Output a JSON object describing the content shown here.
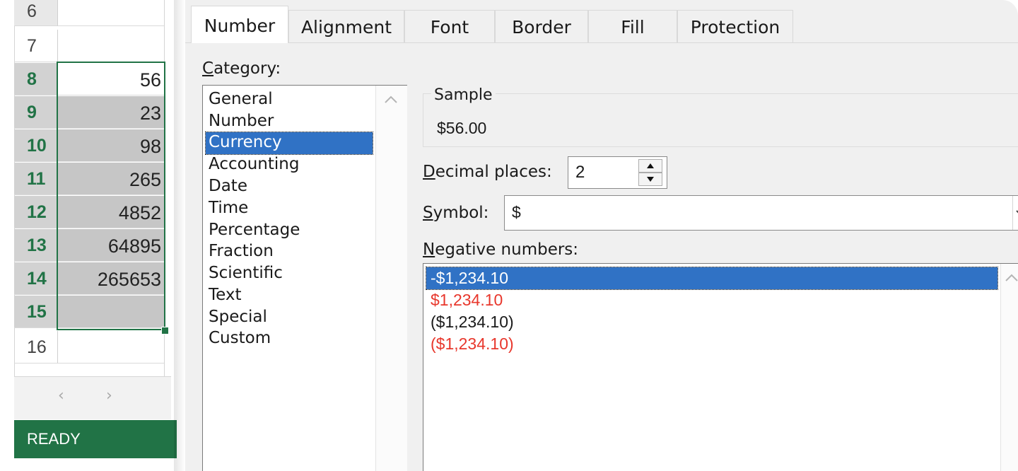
{
  "sheet": {
    "rows": [
      {
        "num": "6",
        "value": ""
      },
      {
        "num": "7",
        "value": ""
      },
      {
        "num": "8",
        "value": "56"
      },
      {
        "num": "9",
        "value": "23"
      },
      {
        "num": "10",
        "value": "98"
      },
      {
        "num": "11",
        "value": "265"
      },
      {
        "num": "12",
        "value": "4852"
      },
      {
        "num": "13",
        "value": "64895"
      },
      {
        "num": "14",
        "value": "265653"
      },
      {
        "num": "15",
        "value": ""
      },
      {
        "num": "16",
        "value": ""
      }
    ],
    "scroll_left_icon": "‹",
    "scroll_right_icon": "›",
    "status": "READY",
    "accent_color": "#217346"
  },
  "dialog": {
    "tabs": [
      "Number",
      "Alignment",
      "Font",
      "Border",
      "Fill",
      "Protection"
    ],
    "active_tab": "Number",
    "category": {
      "label_underlined": "C",
      "label_rest": "ategory:",
      "items": [
        "General",
        "Number",
        "Currency",
        "Accounting",
        "Date",
        "Time",
        "Percentage",
        "Fraction",
        "Scientific",
        "Text",
        "Special",
        "Custom"
      ],
      "selected": "Currency"
    },
    "sample": {
      "label": "Sample",
      "value": "$56.00"
    },
    "decimal_places": {
      "label_underlined": "D",
      "label_rest": "ecimal places:",
      "value": "2"
    },
    "symbol": {
      "label_underlined": "S",
      "label_rest": "ymbol:",
      "value": "$"
    },
    "negative_numbers": {
      "label_underlined": "N",
      "label_rest": "egative numbers:",
      "items": [
        {
          "text": "-$1,234.10",
          "color": "#ffffff"
        },
        {
          "text": "$1,234.10",
          "color": "#e8372c"
        },
        {
          "text": "($1,234.10)",
          "color": "#1a1a1a"
        },
        {
          "text": "($1,234.10)",
          "color": "#e8372c"
        }
      ],
      "selected_index": 0
    },
    "selection_color": "#3072c5"
  }
}
